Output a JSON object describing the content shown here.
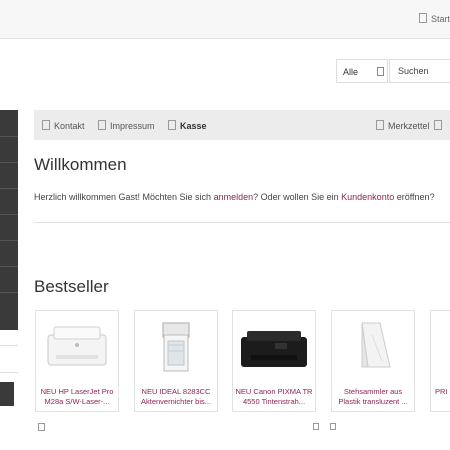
{
  "topbar": {
    "start_label": "Start"
  },
  "search": {
    "category_label": "Alle",
    "input_value": "Suchen"
  },
  "nav": {
    "contact_label": "Kontakt",
    "imprint_label": "Impressum",
    "checkout_label": "Kasse",
    "wishlist_label": "Merkzettel"
  },
  "welcome": {
    "title": "Willkommen",
    "text_part1": "Herzlich willkommen Gast! Möchten Sie sich ",
    "login_link": "anmelden",
    "text_part2": "? Oder wollen Sie ein ",
    "account_link": "Kundenkonto",
    "text_part3": " eröffnen?"
  },
  "bestseller": {
    "title": "Bestseller",
    "products": [
      {
        "name": "NEU HP LaserJet Pro M28a S/W-Laser-..."
      },
      {
        "name": "NEU IDEAL 8283CC Aktenvernichter bis..."
      },
      {
        "name": "NEU Canon PIXMA TR 4550 Tintenstrah..."
      },
      {
        "name": "Stehsammler aus Plastik transluzent ..."
      },
      {
        "name": "PRI"
      }
    ]
  },
  "colors": {
    "link": "#8e2357",
    "sidebar": "#3a3a3a",
    "navbar_bg": "#ececec"
  }
}
